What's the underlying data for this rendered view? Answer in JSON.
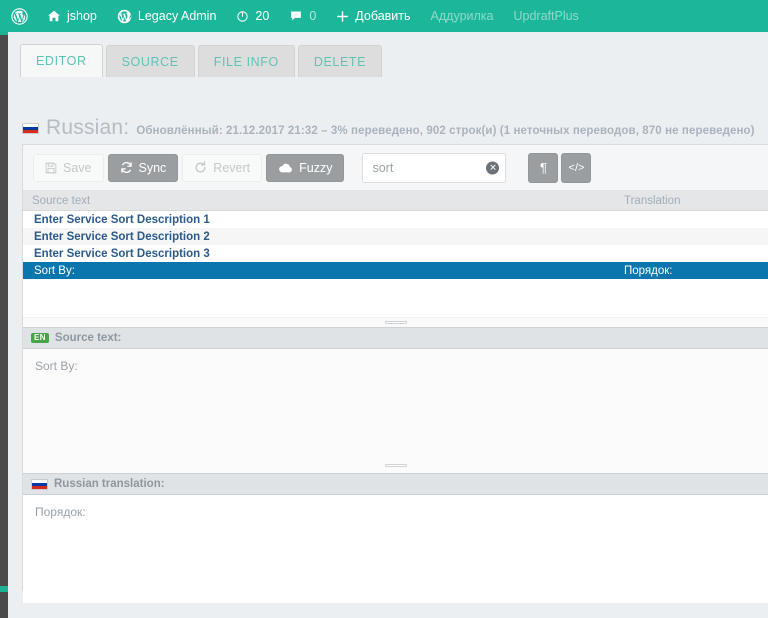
{
  "adminbar": {
    "items": [
      {
        "name": "wordpress-logo",
        "label": "",
        "icon": "wordpress-icon",
        "muted": false
      },
      {
        "name": "site-name",
        "label": "jshop",
        "icon": "home-icon",
        "muted": false
      },
      {
        "name": "legacy-admin",
        "label": "Legacy Admin",
        "icon": "wordpress-icon",
        "muted": false
      },
      {
        "name": "updates",
        "label": "20",
        "icon": "update-icon",
        "muted": false
      },
      {
        "name": "comments",
        "label": "0",
        "icon": "comment-icon",
        "muted": false
      },
      {
        "name": "new-content",
        "label": "Добавить",
        "icon": "plus-icon",
        "muted": false
      },
      {
        "name": "addurilka",
        "label": "Аддурилка",
        "icon": "",
        "muted": true
      },
      {
        "name": "updraftplus",
        "label": "UpdraftPlus",
        "icon": "",
        "muted": true
      }
    ]
  },
  "tabs": [
    {
      "label": "EDITOR",
      "active": true
    },
    {
      "label": "SOURCE",
      "active": false
    },
    {
      "label": "FILE INFO",
      "active": false
    },
    {
      "label": "DELETE",
      "active": false
    }
  ],
  "file": {
    "flag": "ru-flag-icon",
    "language": "Russian:",
    "meta": "Обновлённый: 21.12.2017 21:32 – 3% переведено, 902 строк(и) (1 неточных переводов, 870 не переведено)"
  },
  "toolbar": {
    "buttons": [
      {
        "label": "Save",
        "icon": "floppy-icon",
        "state": "disabled"
      },
      {
        "label": "Sync",
        "icon": "sync-icon",
        "state": "enabled"
      },
      {
        "label": "Revert",
        "icon": "revert-icon",
        "state": "disabled"
      },
      {
        "label": "Fuzzy",
        "icon": "cloud-icon",
        "state": "enabled"
      }
    ],
    "search": {
      "value": "sort",
      "placeholder": "Search",
      "clear_icon": "clear-circle-icon"
    },
    "toggles": [
      {
        "name": "whitespace-toggle",
        "glyph": "¶",
        "icon": "pilcrow-icon"
      },
      {
        "name": "code-view-toggle",
        "glyph": "</>",
        "icon": "code-icon"
      }
    ]
  },
  "list": {
    "columns": [
      "Source text",
      "Translation"
    ],
    "rows": [
      {
        "source": "Enter Service Sort Description 1",
        "translation": "",
        "status": "untranslated",
        "selected": false
      },
      {
        "source": "Enter Service Sort Description 2",
        "translation": "",
        "status": "untranslated",
        "selected": false
      },
      {
        "source": "Enter Service Sort Description 3",
        "translation": "",
        "status": "untranslated",
        "selected": false
      },
      {
        "source": "Sort By:",
        "translation": "Порядок:",
        "status": "translated",
        "selected": true
      }
    ]
  },
  "source_panel": {
    "badge": "EN",
    "title": "Source text:",
    "content": "Sort By:"
  },
  "translation_panel": {
    "flag": "ru-flag-icon",
    "title": "Russian translation:",
    "content": "Порядок:"
  },
  "colors": {
    "adminbar": "#1cb79b",
    "tab_text": "#5ec4b6",
    "selected_row": "#0a76ad",
    "untranslated_text": "#2b5a8c",
    "badge_en": "#46a546"
  }
}
